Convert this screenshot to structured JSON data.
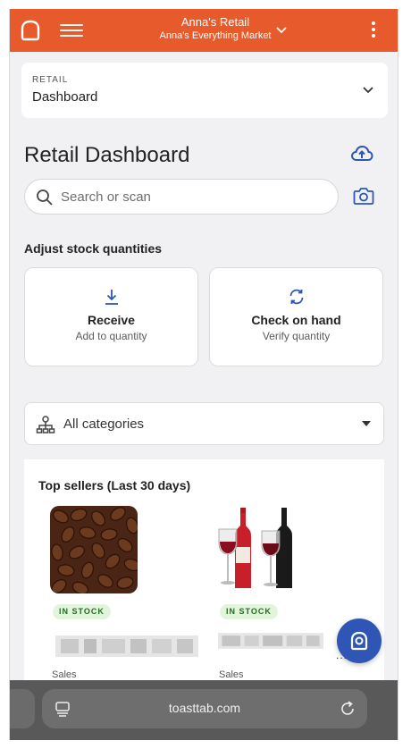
{
  "topbar": {
    "store_name": "Anna's Retail",
    "store_subtitle": "Anna's Everything Market"
  },
  "section": {
    "category": "RETAIL",
    "value": "Dashboard"
  },
  "page": {
    "title": "Retail Dashboard"
  },
  "search": {
    "placeholder": "Search or scan"
  },
  "adjust": {
    "heading": "Adjust stock quantities",
    "actions": [
      {
        "title": "Receive",
        "subtitle": "Add to quantity",
        "icon": "download-icon"
      },
      {
        "title": "Check on hand",
        "subtitle": "Verify quantity",
        "icon": "refresh-icon"
      }
    ]
  },
  "categories": {
    "selected": "All categories"
  },
  "top_sellers": {
    "heading": "Top sellers (Last 30 days)",
    "products": [
      {
        "image": "coffee-beans-image",
        "stock_badge": "IN STOCK",
        "sales_label": "Sales"
      },
      {
        "image": "wine-bottles-image",
        "stock_badge": "IN STOCK",
        "sales_label": "Sales"
      }
    ],
    "more_indicator": "..."
  },
  "browser": {
    "url": "toasttab.com"
  },
  "colors": {
    "brand_orange": "#e75a2b",
    "accent_blue": "#2f56b5",
    "stock_green": "#1f6e21",
    "stock_bg": "#e3f4dc"
  }
}
